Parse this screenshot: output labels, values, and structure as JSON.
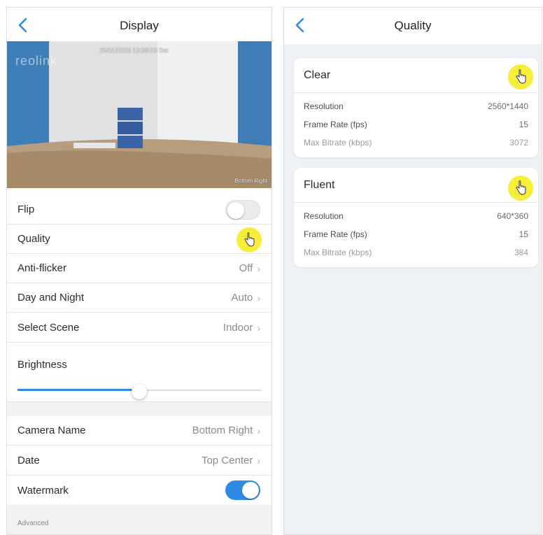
{
  "left": {
    "title": "Display",
    "preview": {
      "watermark": "reolink",
      "timestamp": "25/01/2023 13:08:03 Sat",
      "camera_label": "Bottom Right"
    },
    "rows": {
      "flip": {
        "label": "Flip",
        "toggle": "off"
      },
      "quality": {
        "label": "Quality"
      },
      "anti_flicker": {
        "label": "Anti-flicker",
        "value": "Off"
      },
      "day_night": {
        "label": "Day and Night",
        "value": "Auto"
      },
      "scene": {
        "label": "Select Scene",
        "value": "Indoor"
      },
      "brightness": {
        "label": "Brightness",
        "level_percent": 50
      },
      "camera_name": {
        "label": "Camera Name",
        "value": "Bottom Right"
      },
      "date": {
        "label": "Date",
        "value": "Top Center"
      },
      "watermark": {
        "label": "Watermark",
        "toggle": "on"
      }
    },
    "advanced_label": "Advanced"
  },
  "right": {
    "title": "Quality",
    "cards": [
      {
        "name": "Clear",
        "rows": [
          {
            "key": "Resolution",
            "value": "2560*1440"
          },
          {
            "key": "Frame Rate (fps)",
            "value": "15"
          },
          {
            "key": "Max Bitrate (kbps)",
            "value": "3072"
          }
        ]
      },
      {
        "name": "Fluent",
        "rows": [
          {
            "key": "Resolution",
            "value": "640*360"
          },
          {
            "key": "Frame Rate (fps)",
            "value": "15"
          },
          {
            "key": "Max Bitrate (kbps)",
            "value": "384"
          }
        ]
      }
    ]
  },
  "colors": {
    "accent": "#2e8be8",
    "highlight": "#f7ee3a"
  },
  "icons": {
    "back": "chevron-left-icon",
    "chevron": "chevron-right-icon",
    "pointer": "hand-pointer-icon"
  }
}
